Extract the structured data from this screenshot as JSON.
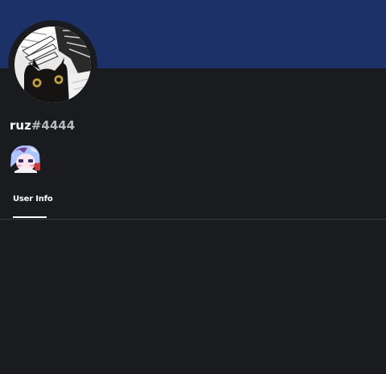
{
  "profile": {
    "username": "ruz",
    "discriminator": "#4444"
  },
  "tabs": [
    {
      "label": "User Info",
      "active": true
    }
  ],
  "colors": {
    "banner": "#1b3168",
    "background": "#1a1b1f",
    "text": "#ffffff",
    "discriminator": "#b7b9bf"
  }
}
